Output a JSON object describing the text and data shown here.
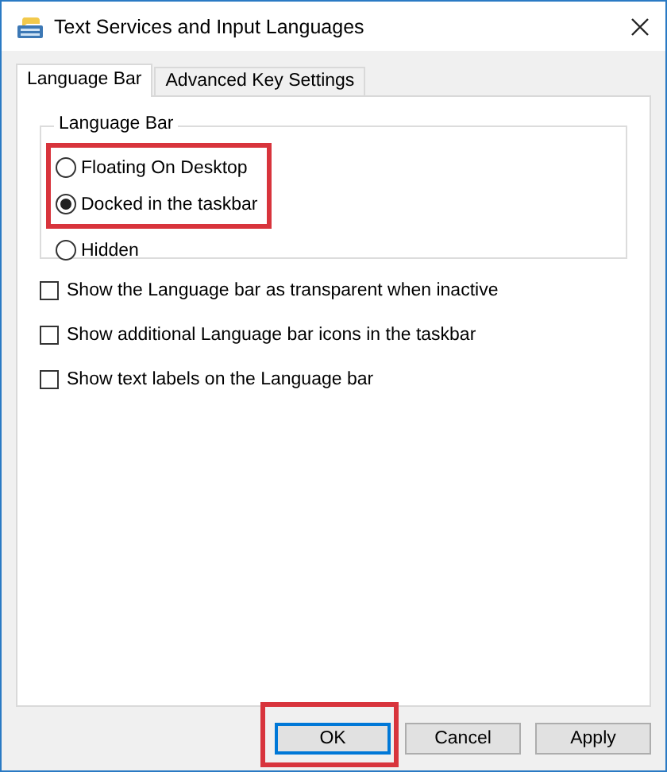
{
  "window": {
    "title": "Text Services and Input Languages"
  },
  "tabs": [
    {
      "label": "Language Bar",
      "selected": true
    },
    {
      "label": "Advanced Key Settings",
      "selected": false
    }
  ],
  "language_bar_group": {
    "title": "Language Bar",
    "options": [
      {
        "label": "Floating On Desktop",
        "selected": false,
        "highlighted": true
      },
      {
        "label": "Docked in the taskbar",
        "selected": true,
        "highlighted": true
      },
      {
        "label": "Hidden",
        "selected": false,
        "highlighted": false
      }
    ]
  },
  "checkboxes": [
    {
      "label": "Show the Language bar as transparent when inactive",
      "checked": false
    },
    {
      "label": "Show additional Language bar icons in the taskbar",
      "checked": false
    },
    {
      "label": "Show text labels on the Language bar",
      "checked": false
    }
  ],
  "buttons": [
    {
      "label": "OK",
      "default": true,
      "highlighted": true
    },
    {
      "label": "Cancel",
      "default": false,
      "highlighted": false
    },
    {
      "label": "Apply",
      "default": false,
      "highlighted": false
    }
  ]
}
